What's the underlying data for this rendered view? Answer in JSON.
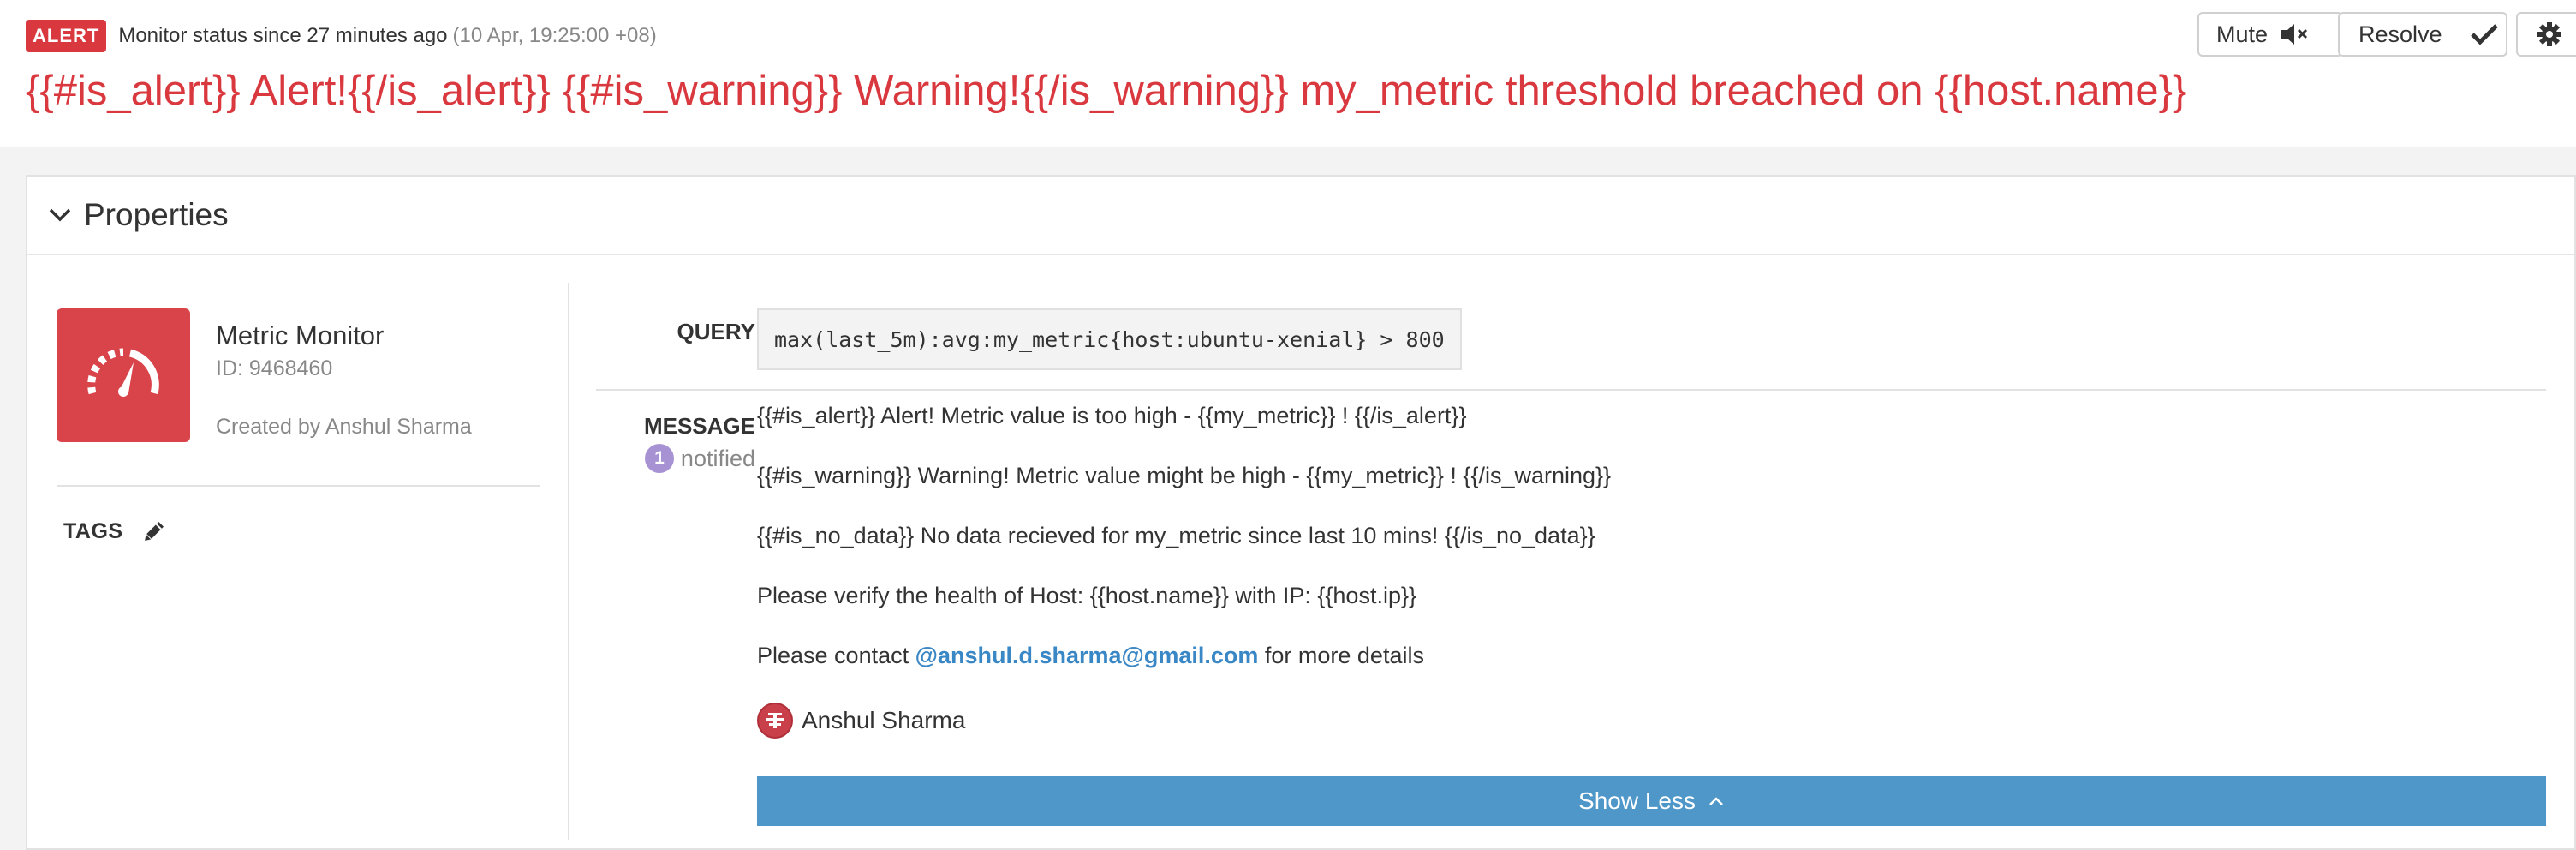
{
  "header": {
    "badge": "ALERT",
    "status_text": "Monitor status since 27 minutes ago",
    "status_time": "(10 Apr, 19:25:00 +08)",
    "title": "{{#is_alert}} Alert!{{/is_alert}} {{#is_warning}} Warning!{{/is_warning}} my_metric threshold breached on {{host.name}}",
    "buttons": {
      "mute_label": "Mute",
      "mute_icon": "speaker-muted-icon",
      "resolve_label": "Resolve",
      "resolve_icon": "checkmark-icon",
      "settings_icon": "gear-icon"
    }
  },
  "properties": {
    "title": "Properties",
    "collapse_icon": "chevron-down-icon",
    "monitor": {
      "icon": "speedometer-icon",
      "type": "Metric Monitor",
      "id": "ID: 9468460",
      "created_by": "Created by Anshul Sharma"
    },
    "tags": {
      "label": "TAGS",
      "edit_icon": "pencil-icon"
    },
    "query": {
      "label": "QUERY",
      "value": "max(last_5m):avg:my_metric{host:ubuntu-xenial} > 800"
    },
    "message": {
      "label": "MESSAGE",
      "notified_count": "1",
      "notified_label": "notified",
      "lines": [
        "{{#is_alert}} Alert! Metric value is too high - {{my_metric}} ! {{/is_alert}}",
        "{{#is_warning}} Warning! Metric value might be high - {{my_metric}} ! {{/is_warning}}",
        "{{#is_no_data}} No data recieved for my_metric since last 10 mins! {{/is_no_data}}",
        "Please verify the health of Host: {{host.name}} with IP: {{host.ip}}"
      ],
      "contact_prefix": "Please contact ",
      "contact_link": "@anshul.d.sharma@gmail.com",
      "contact_suffix": " for more details",
      "author": "Anshul Sharma"
    },
    "show_less_label": "Show Less",
    "show_less_icon": "chevron-up-icon"
  },
  "colors": {
    "alert_red": "#d9383f",
    "link_blue": "#3a87c6",
    "button_blue": "#4e97c8",
    "notify_purple": "#a793d4"
  }
}
